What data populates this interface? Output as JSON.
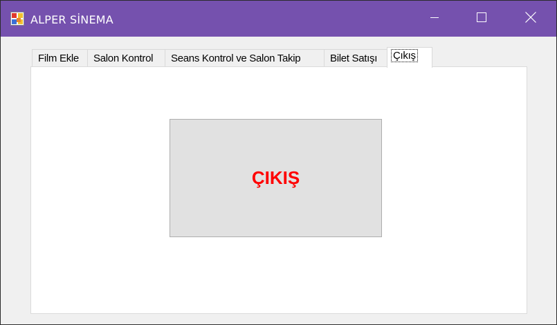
{
  "window": {
    "title": "ALPER SİNEMA",
    "accent_color": "#7551ae",
    "controls": {
      "minimize_icon": "minimize-icon",
      "maximize_icon": "maximize-icon",
      "close_icon": "close-icon"
    }
  },
  "tabs": [
    {
      "label": "Film Ekle"
    },
    {
      "label": "Salon Kontrol"
    },
    {
      "label": "Seans Kontrol ve Salon Takip"
    },
    {
      "label": "Bilet Satışı"
    },
    {
      "label": "Çıkış",
      "selected": true
    }
  ],
  "exit_page": {
    "button_label": "ÇIKIŞ",
    "button_text_color": "#ff0000"
  }
}
